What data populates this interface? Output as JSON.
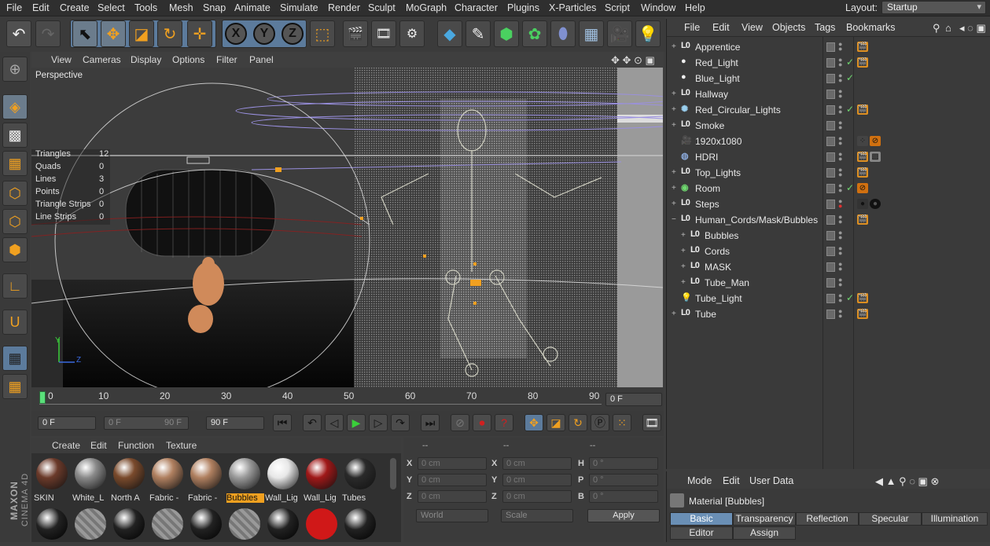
{
  "menubar": {
    "items": [
      "File",
      "Edit",
      "Create",
      "Select",
      "Tools",
      "Mesh",
      "Snap",
      "Animate",
      "Simulate",
      "Render",
      "Sculpt",
      "MoGraph",
      "Character",
      "Plugins",
      "X-Particles",
      "Script",
      "Window",
      "Help"
    ],
    "layout_label": "Layout:",
    "layout_value": "Startup"
  },
  "toolbar": {
    "axis_x": "X",
    "axis_y": "Y",
    "axis_z": "Z"
  },
  "viewport": {
    "menu": [
      "View",
      "Cameras",
      "Display",
      "Options",
      "Filter",
      "Panel"
    ],
    "label": "Perspective",
    "stats": [
      {
        "name": "Triangles",
        "value": "12"
      },
      {
        "name": "Quads",
        "value": "0"
      },
      {
        "name": "Lines",
        "value": "3"
      },
      {
        "name": "Points",
        "value": "0"
      },
      {
        "name": "Triangle Strips",
        "value": "0"
      },
      {
        "name": "Line Strips",
        "value": "0"
      }
    ],
    "axis_y": "Y",
    "axis_z": "Z"
  },
  "timeline": {
    "ticks": [
      "0",
      "10",
      "20",
      "30",
      "40",
      "50",
      "60",
      "70",
      "80",
      "90"
    ],
    "current_frame": "0 F"
  },
  "playbar": {
    "start": "0 F",
    "range_start": "0 F",
    "range_end": "90 F",
    "end": "90 F"
  },
  "material_manager": {
    "menu": [
      "Create",
      "Edit",
      "Function",
      "Texture"
    ],
    "materials": [
      {
        "label": "SKIN",
        "color": "#6b3a2a"
      },
      {
        "label": "White_L",
        "color": "#8a8a8a"
      },
      {
        "label": "North A",
        "color": "#7a4a2c"
      },
      {
        "label": "Fabric -",
        "color": "#b08060"
      },
      {
        "label": "Fabric -",
        "color": "#b08060"
      },
      {
        "label": "Bubbles",
        "color": "#9a9a9a"
      },
      {
        "label": "Wall_Lig",
        "color": "#e8e8e8"
      },
      {
        "label": "Wall_Lig",
        "color": "#a01818"
      },
      {
        "label": "Tubes",
        "color": "#2a2a2a"
      }
    ],
    "selected_index": 5
  },
  "coordinates": {
    "dashes": [
      "--",
      "--",
      "--"
    ],
    "rows": [
      {
        "a": "X",
        "av": "0 cm",
        "b": "X",
        "bv": "0 cm",
        "c": "H",
        "cv": "0 °"
      },
      {
        "a": "Y",
        "av": "0 cm",
        "b": "Y",
        "bv": "0 cm",
        "c": "P",
        "cv": "0 °"
      },
      {
        "a": "Z",
        "av": "0 cm",
        "b": "Z",
        "bv": "0 cm",
        "c": "B",
        "cv": "0 °"
      }
    ],
    "world": "World",
    "scale": "Scale",
    "apply": "Apply"
  },
  "object_manager": {
    "menu": [
      "File",
      "Edit",
      "View",
      "Objects",
      "Tags",
      "Bookmarks"
    ],
    "objects": [
      {
        "name": "Apprentice",
        "icon": "L0",
        "indent": 0,
        "expand": "+",
        "check": false
      },
      {
        "name": "Red_Light",
        "icon": "light",
        "indent": 0,
        "expand": "",
        "check": true
      },
      {
        "name": "Blue_Light",
        "icon": "light",
        "indent": 0,
        "expand": "",
        "check": true
      },
      {
        "name": "Hallway",
        "icon": "L0",
        "indent": 0,
        "expand": "+",
        "check": false
      },
      {
        "name": "Red_Circular_Lights",
        "icon": "gear",
        "indent": 0,
        "expand": "+",
        "check": true
      },
      {
        "name": "Smoke",
        "icon": "L0",
        "indent": 0,
        "expand": "+",
        "check": false
      },
      {
        "name": "1920x1080",
        "icon": "camera",
        "indent": 0,
        "expand": "",
        "check": false
      },
      {
        "name": "HDRI",
        "icon": "sky",
        "indent": 0,
        "expand": "",
        "check": false
      },
      {
        "name": "Top_Lights",
        "icon": "L0",
        "indent": 0,
        "expand": "+",
        "check": false
      },
      {
        "name": "Room",
        "icon": "room",
        "indent": 0,
        "expand": "+",
        "check": true
      },
      {
        "name": "Steps",
        "icon": "L0",
        "indent": 0,
        "expand": "+",
        "check": false
      },
      {
        "name": "Human_Cords/Mask/Bubbles",
        "icon": "L0",
        "indent": 0,
        "expand": "−",
        "check": false
      },
      {
        "name": "Bubbles",
        "icon": "L0",
        "indent": 1,
        "expand": "+",
        "check": false
      },
      {
        "name": "Cords",
        "icon": "L0",
        "indent": 1,
        "expand": "+",
        "check": false
      },
      {
        "name": "MASK",
        "icon": "L0",
        "indent": 1,
        "expand": "+",
        "check": false
      },
      {
        "name": "Tube_Man",
        "icon": "L0",
        "indent": 1,
        "expand": "+",
        "check": false
      },
      {
        "name": "Tube_Light",
        "icon": "bulb",
        "indent": 0,
        "expand": "",
        "check": true
      },
      {
        "name": "Tube",
        "icon": "L0",
        "indent": 0,
        "expand": "+",
        "check": false
      }
    ]
  },
  "attribute_manager": {
    "menu": [
      "Mode",
      "Edit",
      "User Data"
    ],
    "title": "Material [Bubbles]",
    "tabs_row1": [
      "Basic",
      "Transparency",
      "Reflection",
      "Specular",
      "Illumination"
    ],
    "tabs_row2": [
      "Editor",
      "Assign"
    ]
  },
  "brand": {
    "maxon": "MAXON",
    "product": "CINEMA 4D"
  },
  "colors": {
    "accent": "#6a8fb5",
    "selection": "#5c7b9c",
    "check": "#6fd86f",
    "tag_orange": "#e09020"
  }
}
